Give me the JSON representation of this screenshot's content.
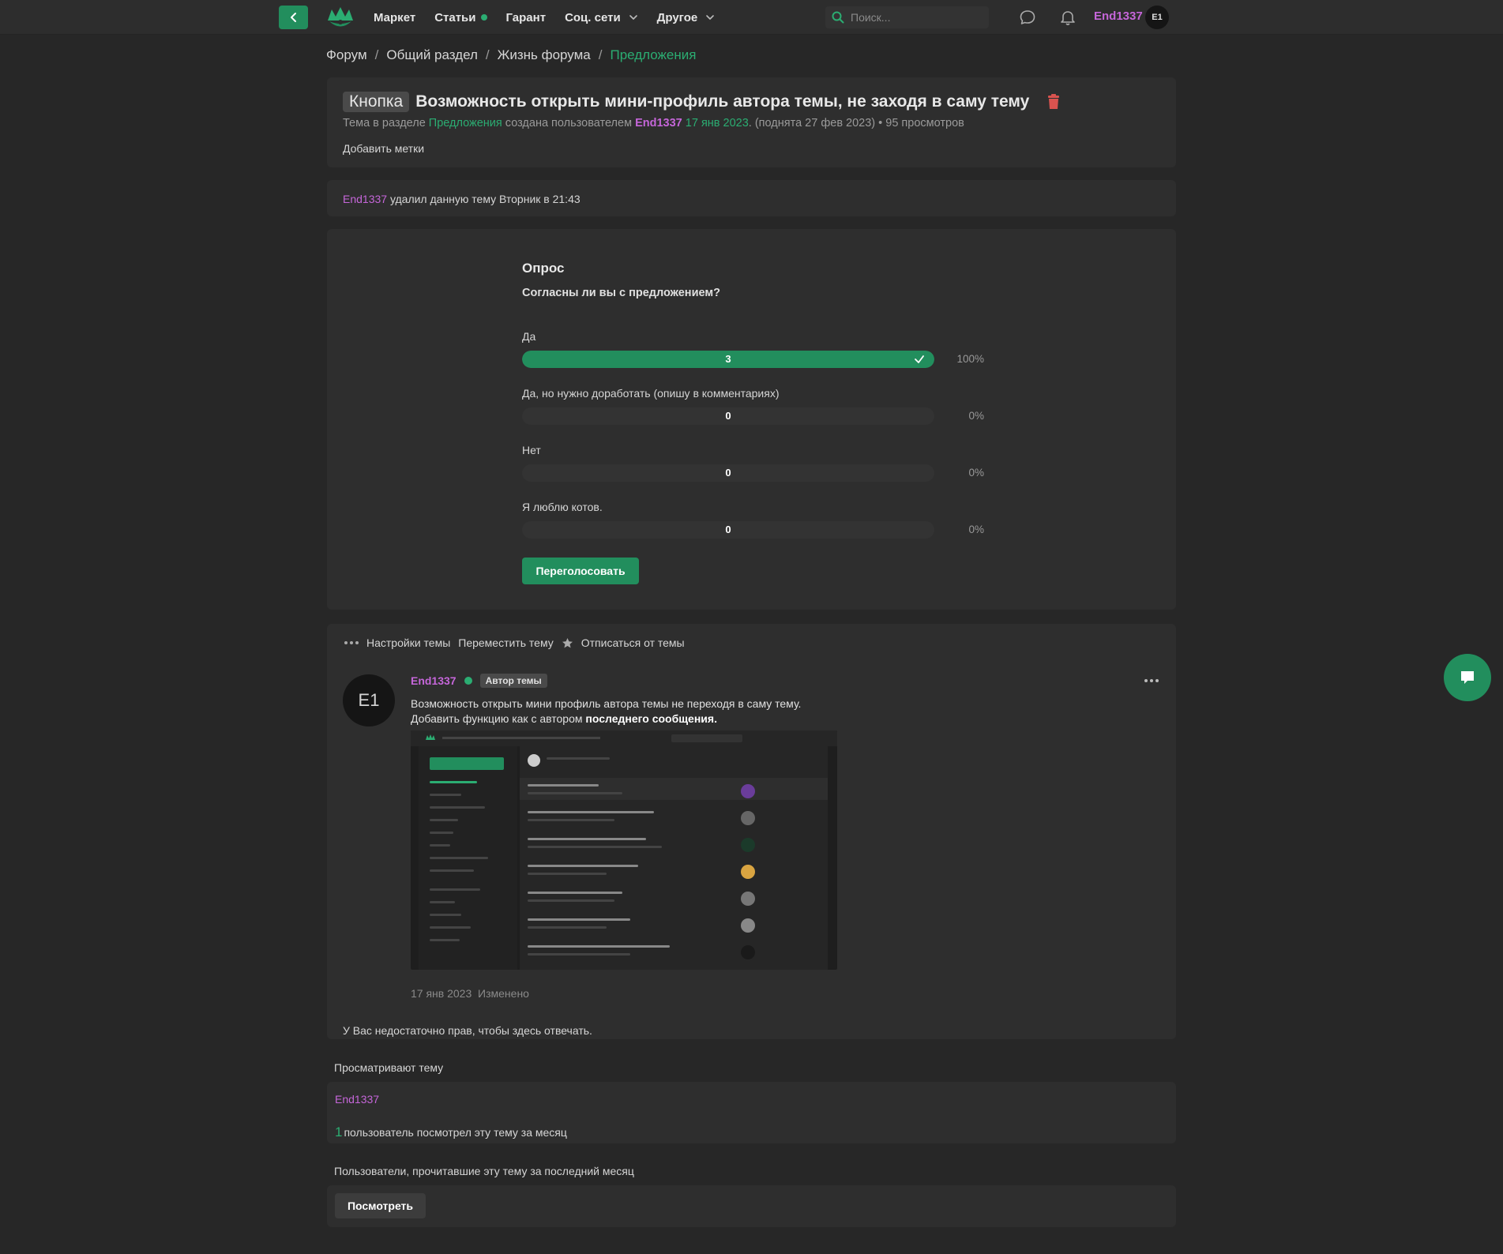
{
  "nav": {
    "items": [
      {
        "label": "Маркет",
        "dot": false,
        "chevron": false
      },
      {
        "label": "Статьи",
        "dot": true,
        "chevron": false
      },
      {
        "label": "Гарант",
        "dot": false,
        "chevron": false
      },
      {
        "label": "Соц. сети",
        "dot": false,
        "chevron": true
      },
      {
        "label": "Другое",
        "dot": false,
        "chevron": true
      }
    ],
    "search_placeholder": "Поиск...",
    "user": "End1337",
    "avatar_initials": "E1"
  },
  "breadcrumb": [
    "Форум",
    "Общий раздел",
    "Жизнь форума",
    "Предложения"
  ],
  "thread": {
    "prefix": "Кнопка",
    "title": "Возможность открыть мини-профиль автора темы, не заходя в саму тему",
    "meta_prefix": "Тема в разделе",
    "meta_section": "Предложения",
    "meta_created_by": "создана пользователем",
    "meta_author": "End1337",
    "meta_date": "17 янв 2023",
    "meta_bumped": ". (поднята 27 фев 2023)",
    "meta_views": "• 95 просмотров",
    "add_tags": "Добавить метки"
  },
  "deleted_notice": {
    "user": "End1337",
    "text": "удалил данную тему Вторник в 21:43"
  },
  "poll": {
    "title": "Опрос",
    "question": "Согласны ли вы с предложением?",
    "options": [
      {
        "label": "Да",
        "count": "3",
        "percent": "100%",
        "fraction": 1.0,
        "voted": true
      },
      {
        "label": "Да, но нужно доработать (опишу в комментариях)",
        "count": "0",
        "percent": "0%",
        "fraction": 0,
        "voted": false
      },
      {
        "label": "Нет",
        "count": "0",
        "percent": "0%",
        "fraction": 0,
        "voted": false
      },
      {
        "label": "Я люблю котов.",
        "count": "0",
        "percent": "0%",
        "fraction": 0,
        "voted": false
      }
    ],
    "revote_label": "Переголосовать"
  },
  "thread_actions": {
    "settings": "Настройки темы",
    "move": "Переместить тему",
    "unsubscribe": "Отписаться от темы"
  },
  "post": {
    "avatar_initials": "E1",
    "author": "End1337",
    "author_badge": "Автор темы",
    "line1": "Возможность открыть мини профиль автора темы не переходя в саму тему.",
    "line2_start": "Добавить функцию как с автором",
    "line2_bold": "последнего сообщения.",
    "date": "17 янв 2023",
    "edited": "Изменено",
    "no_rights": "У Вас недостаточно прав, чтобы здесь отвечать."
  },
  "viewers": {
    "label": "Просматривают тему",
    "name": "End1337",
    "count_num": "1",
    "count_text": "пользователь посмотрел эту тему за месяц"
  },
  "readers": {
    "label": "Пользователи, прочитавшие эту тему за последний месяц",
    "button": "Посмотреть"
  },
  "colors": {
    "accent_green": "#228e5d",
    "text_green": "#2bad72",
    "username_purple": "#c566d9",
    "delete_red": "#d9534f",
    "background": "#272727",
    "card": "#2e2e2e"
  }
}
